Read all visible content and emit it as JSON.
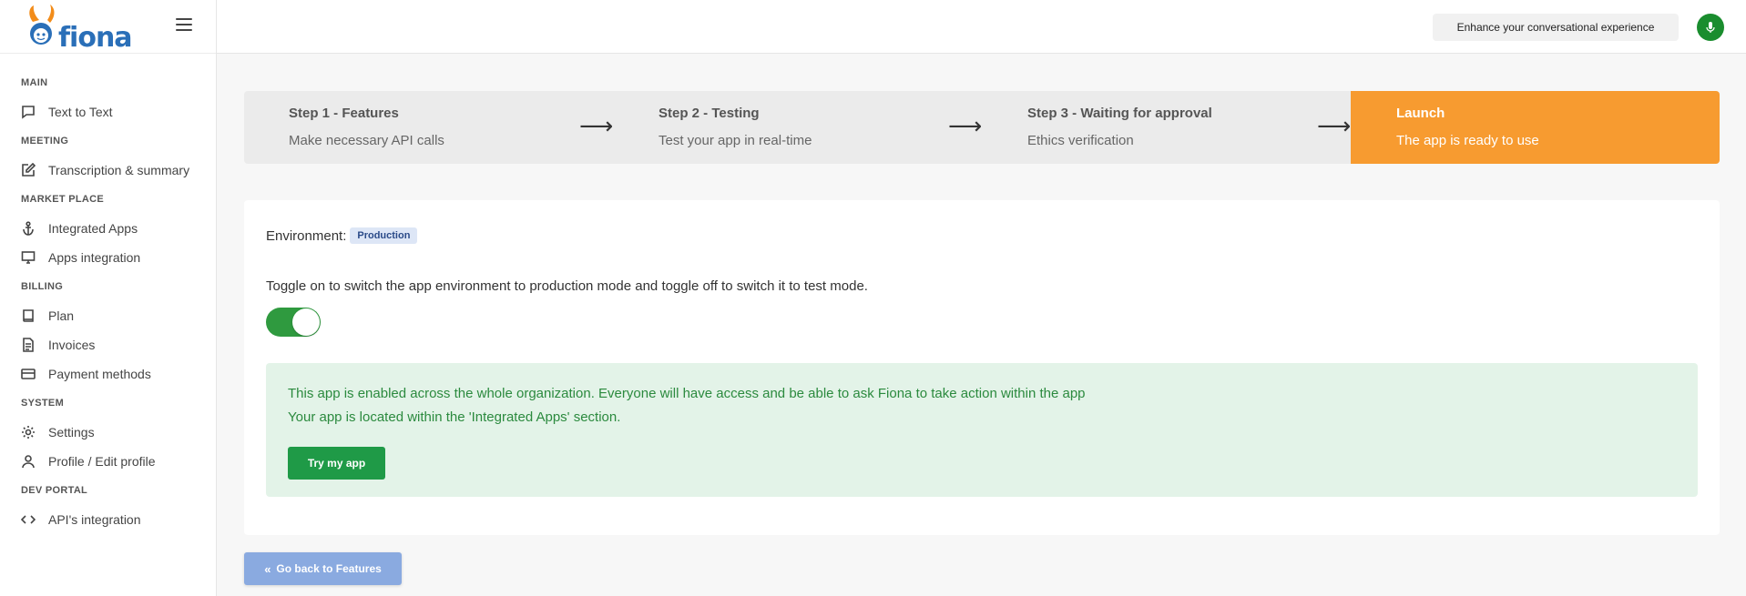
{
  "brand": {
    "logo_text": "fiona"
  },
  "topbar": {
    "enhance_label": "Enhance your conversational experience",
    "mic_icon": "microphone-icon"
  },
  "sidebar": {
    "sections": [
      {
        "title": "MAIN",
        "items": [
          {
            "label": "Text to Text",
            "icon": "chat-icon"
          }
        ]
      },
      {
        "title": "MEETING",
        "items": [
          {
            "label": "Transcription & summary",
            "icon": "edit-icon"
          }
        ]
      },
      {
        "title": "MARKET PLACE",
        "items": [
          {
            "label": "Integrated Apps",
            "icon": "anchor-icon"
          },
          {
            "label": "Apps integration",
            "icon": "monitor-icon"
          }
        ]
      },
      {
        "title": "BILLING",
        "items": [
          {
            "label": "Plan",
            "icon": "book-icon"
          },
          {
            "label": "Invoices",
            "icon": "file-icon"
          },
          {
            "label": "Payment methods",
            "icon": "credit-card-icon"
          }
        ]
      },
      {
        "title": "SYSTEM",
        "items": [
          {
            "label": "Settings",
            "icon": "gear-icon"
          },
          {
            "label": "Profile / Edit profile",
            "icon": "user-icon"
          }
        ]
      },
      {
        "title": "DEV PORTAL",
        "items": [
          {
            "label": "API's integration",
            "icon": "code-icon"
          }
        ]
      }
    ]
  },
  "stepper": {
    "steps": [
      {
        "title": "Step 1 - Features",
        "subtitle": "Make necessary API calls"
      },
      {
        "title": "Step 2 - Testing",
        "subtitle": "Test your app in real-time"
      },
      {
        "title": "Step 3 - Waiting for approval",
        "subtitle": "Ethics verification"
      },
      {
        "title": "Launch",
        "subtitle": "The app is ready to use"
      }
    ],
    "arrow": "⟶",
    "active_color": "#f79b30"
  },
  "environment": {
    "label": "Environment:",
    "badge": "Production",
    "description": "Toggle on to switch the app environment to production mode and toggle off to switch it to test mode.",
    "toggle_on": true
  },
  "alert": {
    "line1": "This app is enabled across the whole organization. Everyone will have access and be able to ask Fiona to take action within the app",
    "line2": "Your app is located within the 'Integrated Apps' section.",
    "button": "Try my app"
  },
  "footer": {
    "back_button": "Go back to Features"
  }
}
